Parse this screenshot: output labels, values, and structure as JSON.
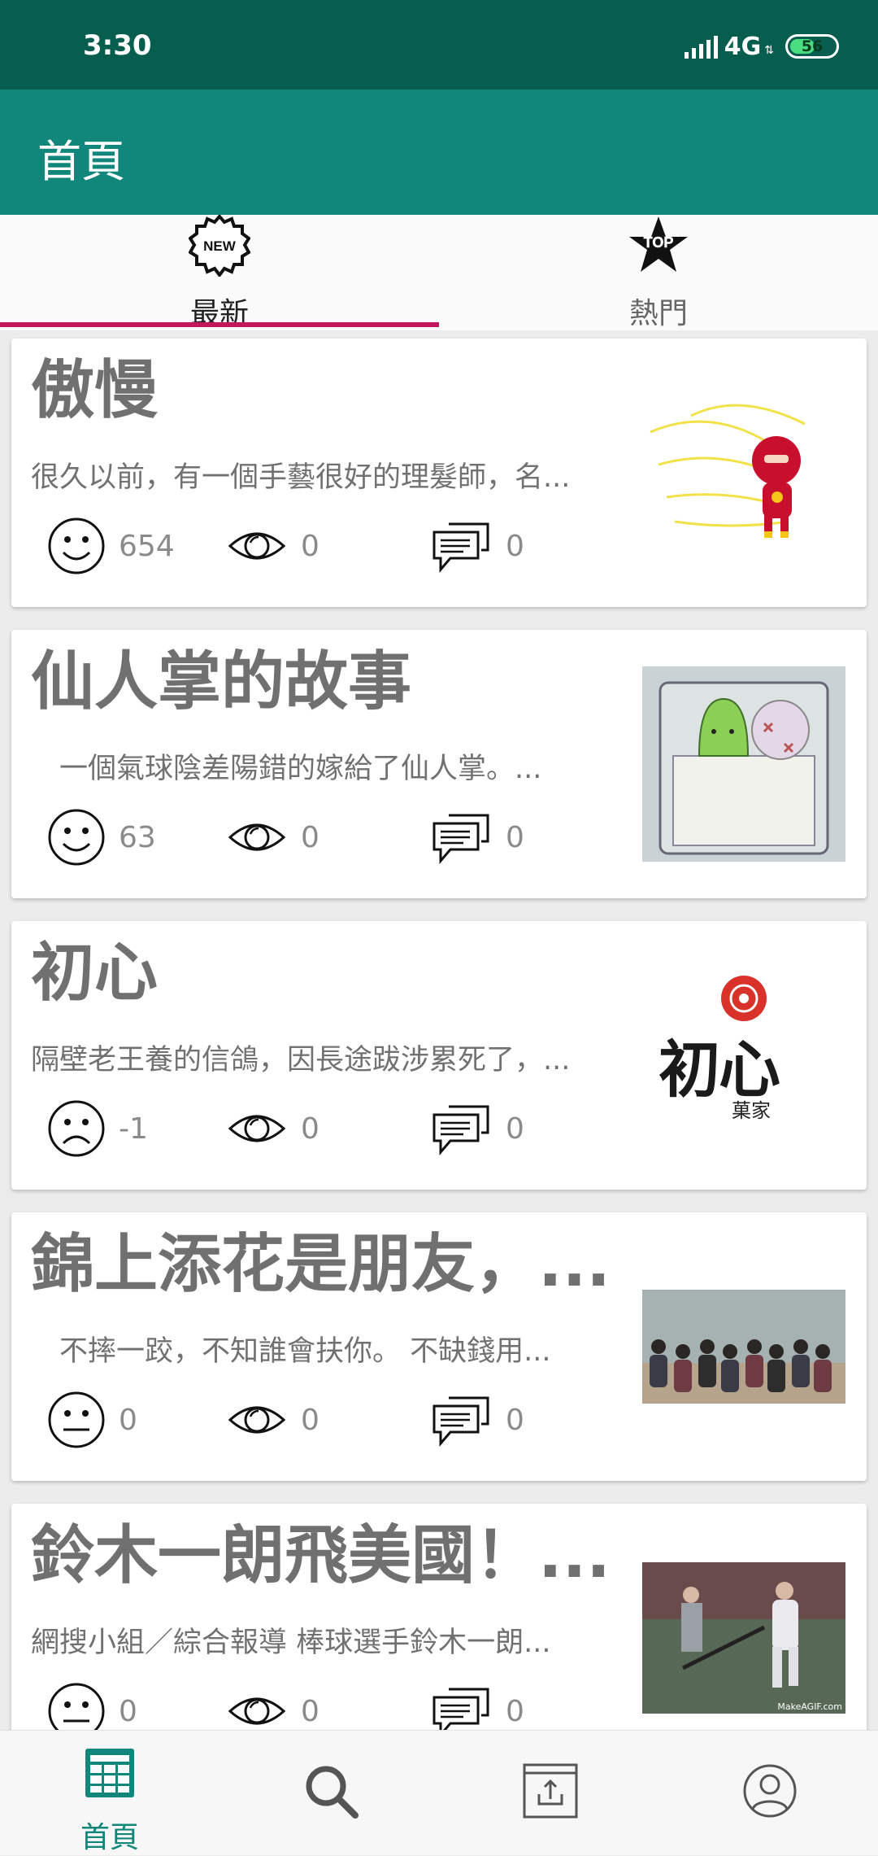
{
  "status_bar": {
    "time": "3:30",
    "network": "4G",
    "battery": "56",
    "battery_level": 0.56
  },
  "app_bar": {
    "title": "首頁"
  },
  "tabs": [
    {
      "label": "最新",
      "icon": "new-badge-icon",
      "icon_text": "NEW",
      "selected": true
    },
    {
      "label": "熱門",
      "icon": "top-star-icon",
      "icon_text": "TOP",
      "selected": false
    }
  ],
  "posts": [
    {
      "title": "傲慢",
      "excerpt": "很久以前，有一個手藝很好的理髮師，名...",
      "mood": "smile",
      "score": "654",
      "views": "0",
      "comments": "0",
      "thumb": "flash-hero-image"
    },
    {
      "title": "仙人掌的故事",
      "excerpt": "　一個氣球陰差陽錯的嫁給了仙人掌。...",
      "mood": "smile",
      "score": "63",
      "views": "0",
      "comments": "0",
      "thumb": "cactus-balloon-image"
    },
    {
      "title": "初心",
      "excerpt": "隔壁老王養的信鴿，因長途跋涉累死了，...",
      "mood": "sad",
      "score": "-1",
      "views": "0",
      "comments": "0",
      "thumb": "chuxin-logo-image",
      "thumb_text": "初心",
      "thumb_subtext": "菓家"
    },
    {
      "title": "錦上添花是朋友，...",
      "excerpt": "　不摔一跤，不知誰會扶你。 不缺錢用...",
      "mood": "neutral",
      "score": "0",
      "views": "0",
      "comments": "0",
      "thumb": "friends-beach-image"
    },
    {
      "title": "鈴木一朗飛美國！...",
      "excerpt": "網搜小組／綜合報導  棒球選手鈴木一朗...",
      "mood": "neutral",
      "score": "0",
      "views": "0",
      "comments": "0",
      "thumb": "baseball-player-image",
      "thumb_caption": "MakeAGIF.com"
    }
  ],
  "bottom_nav": [
    {
      "label": "首頁",
      "icon": "home-table-icon",
      "selected": true
    },
    {
      "label": "",
      "icon": "search-icon",
      "selected": false
    },
    {
      "label": "",
      "icon": "upload-icon",
      "selected": false
    },
    {
      "label": "",
      "icon": "account-icon",
      "selected": false
    }
  ],
  "colors": {
    "status_bar": "#075e4f",
    "app_bar": "#10877a",
    "tab_indicator": "#c2185b",
    "accent": "#10877a"
  }
}
